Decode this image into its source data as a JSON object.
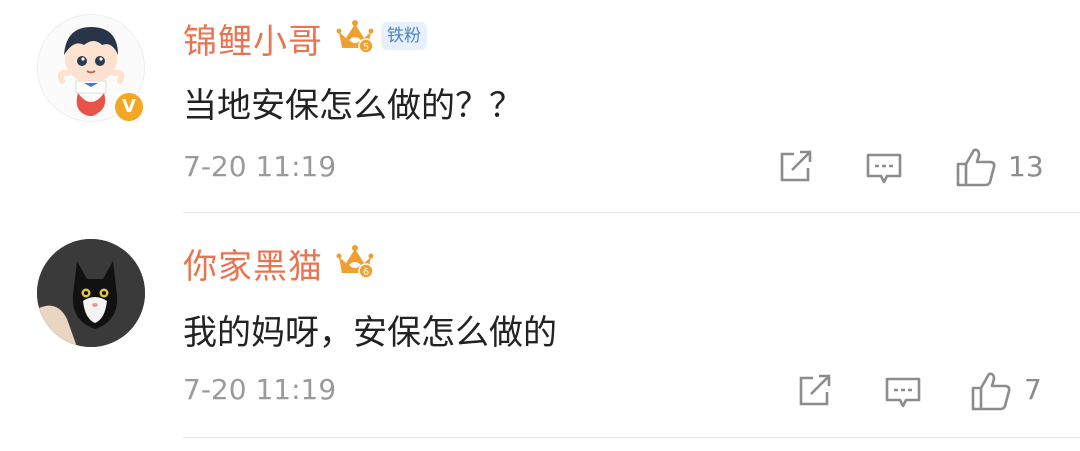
{
  "comments": [
    {
      "username": "锦鲤小哥",
      "crown_level": "5",
      "fan_badge": "铁粉",
      "content": "当地安保怎么做的？？",
      "time": "7-20 11:19",
      "likes": "13",
      "avatar": "cartoon-boy-avatar",
      "verified": true
    },
    {
      "username": "你家黑猫",
      "crown_level": "6",
      "content": "我的妈呀，安保怎么做的",
      "time": "7-20 11:19",
      "likes": "7",
      "avatar": "black-cat-avatar"
    }
  ],
  "colors": {
    "username": "#eb7350",
    "crown": "#f0a030",
    "verified": "#f5a623",
    "fan_badge_bg": "#e7f0fb",
    "fan_badge_text": "#4a86c5",
    "meta": "#9a9a9a"
  }
}
